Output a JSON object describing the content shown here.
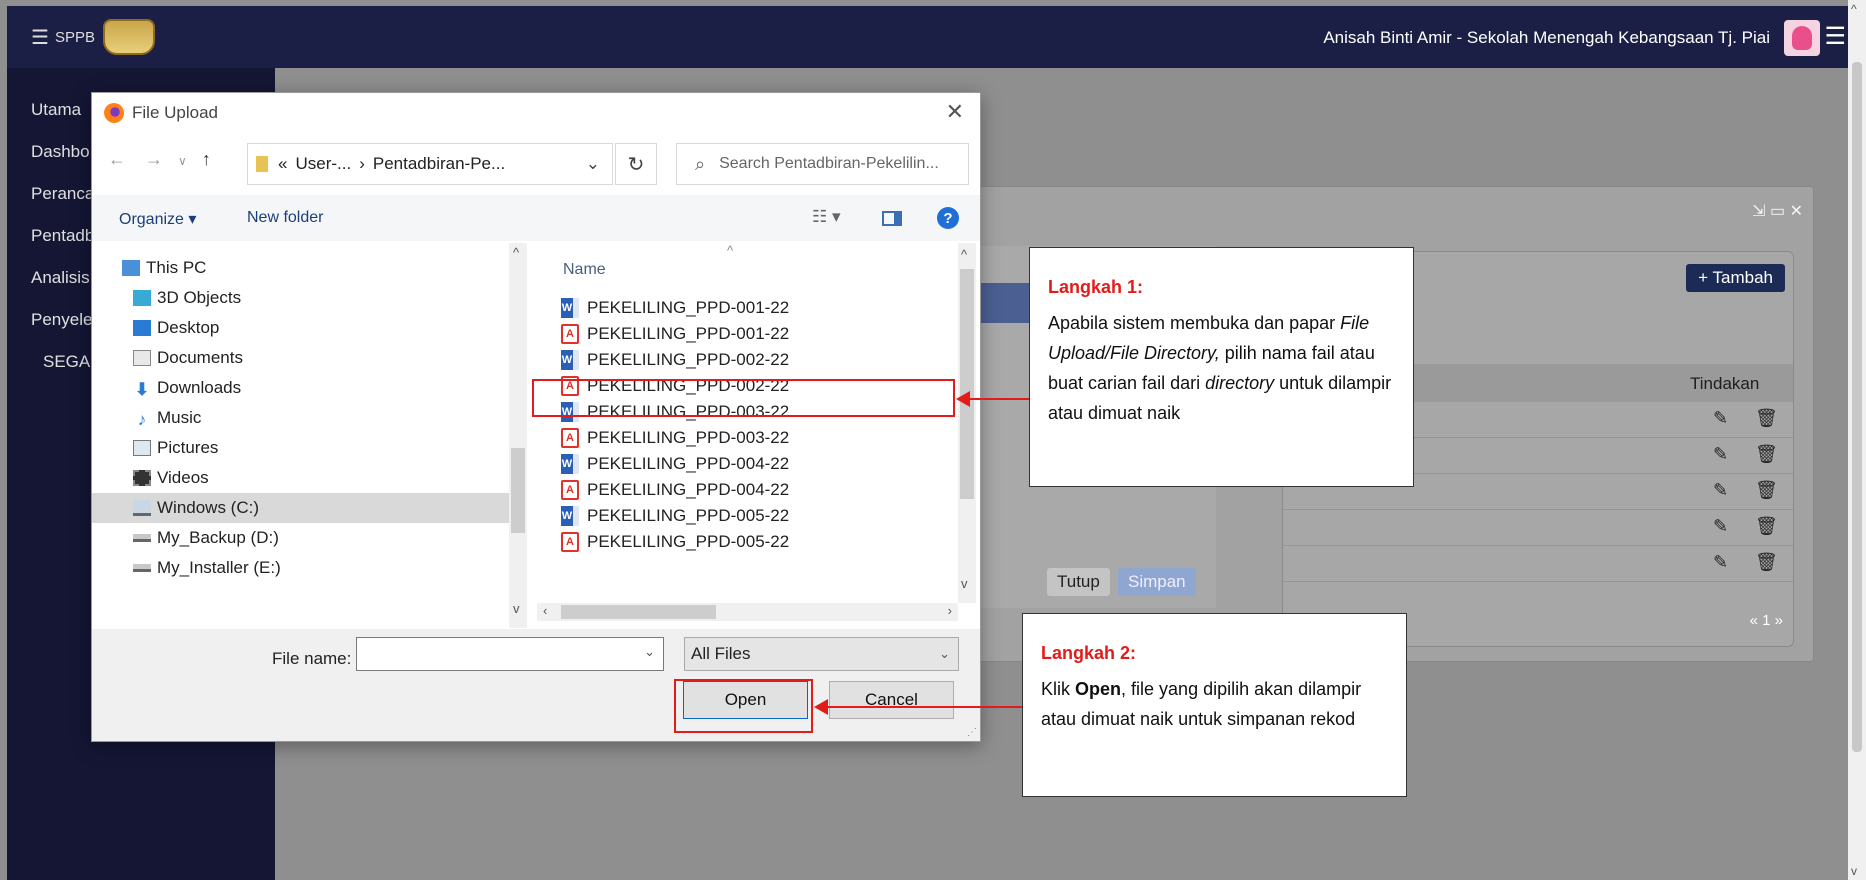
{
  "topbar": {
    "brand": "SPPB",
    "user": "Anisah Binti Amir - Sekolah Menengah Kebangsaan Tj. Piai"
  },
  "sidebar": {
    "items": [
      "Utama",
      "Dashbo",
      "Peranca",
      "Pentadb",
      "Analisis",
      "Penyele",
      "SEGA"
    ]
  },
  "panel": {
    "add_label": "+ Tambah",
    "action_header": "Tindakan",
    "pager": "« 1 »",
    "close_label": "Tutup",
    "save_label": "Simpan"
  },
  "dialog": {
    "title": "File Upload",
    "address_prefix": "«",
    "address_crumb1": "User-...",
    "address_sep": "›",
    "address_crumb2": "Pentadbiran-Pe...",
    "search_placeholder": "Search Pentadbiran-Pekelilin...",
    "organize": "Organize",
    "new_folder": "New folder",
    "nav_items": [
      {
        "label": "This PC",
        "icon": "pc-icon"
      },
      {
        "label": "3D Objects",
        "icon": "3d-objects-icon"
      },
      {
        "label": "Desktop",
        "icon": "desktop-icon"
      },
      {
        "label": "Documents",
        "icon": "documents-icon"
      },
      {
        "label": "Downloads",
        "icon": "downloads-icon"
      },
      {
        "label": "Music",
        "icon": "music-icon"
      },
      {
        "label": "Pictures",
        "icon": "pictures-icon"
      },
      {
        "label": "Videos",
        "icon": "videos-icon"
      },
      {
        "label": "Windows (C:)",
        "icon": "drive-icon"
      },
      {
        "label": "My_Backup (D:)",
        "icon": "drive-icon"
      },
      {
        "label": "My_Installer (E:)",
        "icon": "drive-icon"
      }
    ],
    "name_header": "Name",
    "files": [
      {
        "name": "PEKELILING_PPD-001-22",
        "type": "word"
      },
      {
        "name": "PEKELILING_PPD-001-22",
        "type": "pdf"
      },
      {
        "name": "PEKELILING_PPD-002-22",
        "type": "word"
      },
      {
        "name": "PEKELILING_PPD-002-22",
        "type": "pdf"
      },
      {
        "name": "PEKELILING_PPD-003-22",
        "type": "word"
      },
      {
        "name": "PEKELILING_PPD-003-22",
        "type": "pdf"
      },
      {
        "name": "PEKELILING_PPD-004-22",
        "type": "word"
      },
      {
        "name": "PEKELILING_PPD-004-22",
        "type": "pdf"
      },
      {
        "name": "PEKELILING_PPD-005-22",
        "type": "word"
      },
      {
        "name": "PEKELILING_PPD-005-22",
        "type": "pdf"
      }
    ],
    "file_name_label": "File name:",
    "file_name_value": "",
    "file_type": "All Files",
    "open": "Open",
    "cancel": "Cancel"
  },
  "callout1": {
    "title": "Langkah 1:",
    "t1": "Apabila sistem membuka dan papar ",
    "t2": "File Upload/File Directory,",
    "t3": " pilih nama fail atau buat carian fail dari ",
    "t4": "directory",
    "t5": " untuk dilampir atau dimuat naik"
  },
  "callout2": {
    "title": "Langkah 2:",
    "t1": "Klik ",
    "t2": "Open",
    "t3": ", file yang dipilih akan dilampir atau dimuat naik untuk simpanan rekod"
  },
  "colors": {
    "navbar": "#1c1f45",
    "sidebar": "#141634",
    "annotation": "#e41b1b",
    "accent": "#0a64c9"
  }
}
